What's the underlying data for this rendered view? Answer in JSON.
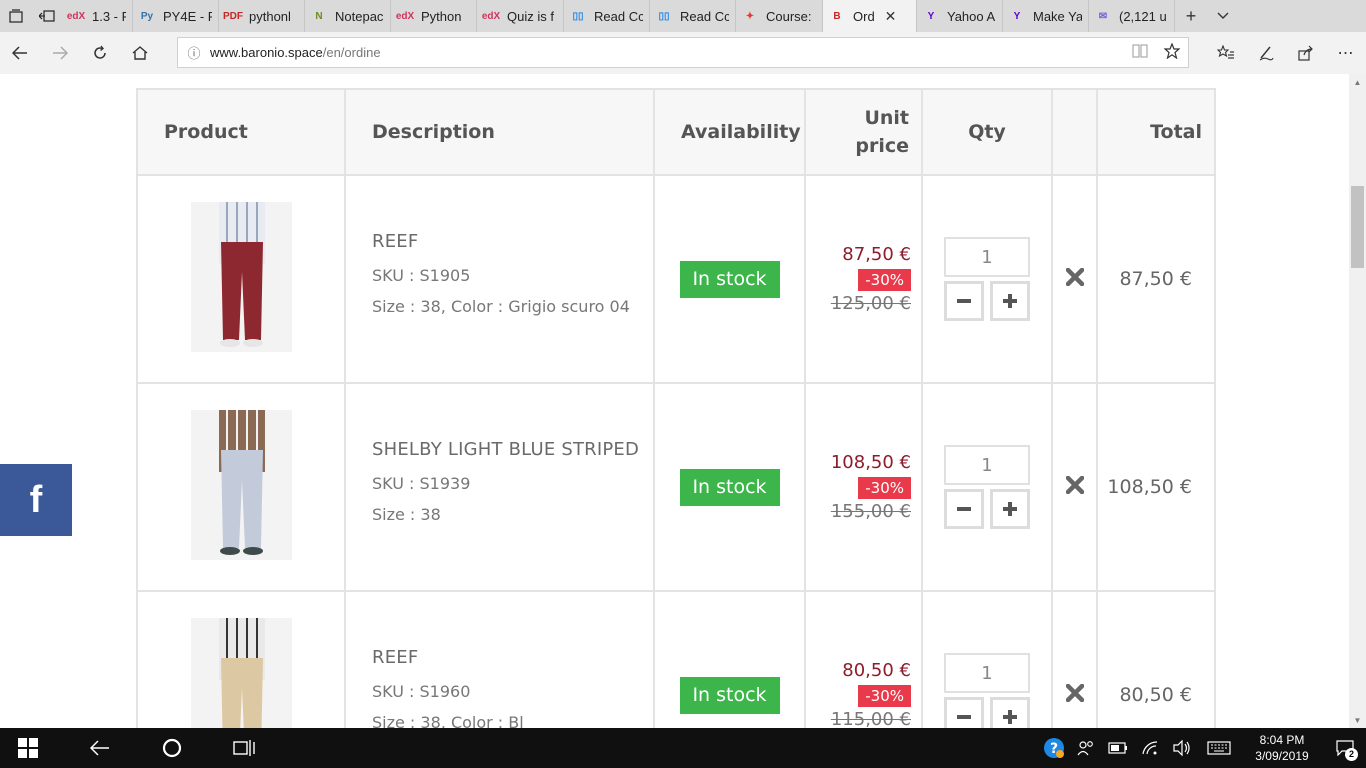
{
  "browser": {
    "tabs": [
      {
        "title": "1.3 - Pyt",
        "icon": "edx-icon",
        "color": "#d1345b",
        "icon_text": "edX"
      },
      {
        "title": "PY4E - F",
        "icon": "python-icon",
        "color": "#3572A5",
        "icon_text": "Py"
      },
      {
        "title": "pythonl",
        "icon": "pdf-icon",
        "color": "#c62828",
        "icon_text": "PDF"
      },
      {
        "title": "Notepac",
        "icon": "notepad-icon",
        "color": "#6b8e23",
        "icon_text": "N"
      },
      {
        "title": "Python",
        "icon": "edx-icon",
        "color": "#d1345b",
        "icon_text": "edX"
      },
      {
        "title": "Quiz is f",
        "icon": "edx-icon",
        "color": "#d1345b",
        "icon_text": "edX"
      },
      {
        "title": "Read Cc",
        "icon": "book-icon",
        "color": "#1e88e5",
        "icon_text": "▯▯"
      },
      {
        "title": "Read Cc",
        "icon": "book-icon",
        "color": "#1e88e5",
        "icon_text": "▯▯"
      },
      {
        "title": "Course:",
        "icon": "course-icon",
        "color": "#e53935",
        "icon_text": "✦"
      },
      {
        "title": "Ord",
        "icon": "baronio-icon",
        "color": "#c62828",
        "icon_text": "B",
        "active": true
      },
      {
        "title": "Yahoo A",
        "icon": "yahoo-icon",
        "color": "#6001d2",
        "icon_text": "Y"
      },
      {
        "title": "Make Ya",
        "icon": "yahoo-icon",
        "color": "#6001d2",
        "icon_text": "Y"
      },
      {
        "title": "(2,121 u",
        "icon": "mail-icon",
        "color": "#7b5bd6",
        "icon_text": "✉"
      }
    ],
    "url_host": "www.baronio.space",
    "url_path": "/en/ordine"
  },
  "cart": {
    "headers": {
      "product": "Product",
      "description": "Description",
      "availability": "Availability",
      "unit_price_1": "Unit",
      "unit_price_2": "price",
      "qty": "Qty",
      "total": "Total"
    },
    "items": [
      {
        "name": "REEF",
        "sku": "SKU : S1905",
        "variant": "Size : 38, Color : Grigio scuro 04",
        "availability": "In stock",
        "price": "87,50 €",
        "discount": "-30%",
        "old_price": "125,00 €",
        "qty": "1",
        "total": "87,50 €",
        "image": {
          "top": "#e8ecf2",
          "stripe": "#9aa6bb",
          "pants": "#8e2830",
          "shoes": "#e6e6e6"
        }
      },
      {
        "name": "SHELBY LIGHT BLUE STRIPED",
        "sku": "SKU : S1939",
        "variant": "Size : 38",
        "availability": "In stock",
        "price": "108,50 €",
        "discount": "-30%",
        "old_price": "155,00 €",
        "qty": "1",
        "total": "108,50 €",
        "image": {
          "top": "#8a6a55",
          "stripe": "#f2f2f2",
          "pants": "#c3cbdb",
          "shoes": "#3f4a4a"
        }
      },
      {
        "name": "REEF",
        "sku": "SKU : S1960",
        "variant": "Size : 38, Color : Bl",
        "availability": "In stock",
        "price": "80,50 €",
        "discount": "-30%",
        "old_price": "115,00 €",
        "qty": "1",
        "total": "80,50 €",
        "image": {
          "top": "#e9e9e9",
          "stripe": "#333333",
          "pants": "#dcc9a4",
          "shoes": "#d7c29c"
        }
      }
    ]
  },
  "social": {
    "facebook_icon": "facebook-icon",
    "label": "f"
  },
  "taskbar": {
    "time": "8:04 PM",
    "date": "3/09/2019",
    "notification_count": "2"
  },
  "colors": {
    "stock_green": "#3cb54a",
    "price_red": "#8e1c2b",
    "discount_red": "#e83a4a",
    "facebook_blue": "#3b5998"
  }
}
